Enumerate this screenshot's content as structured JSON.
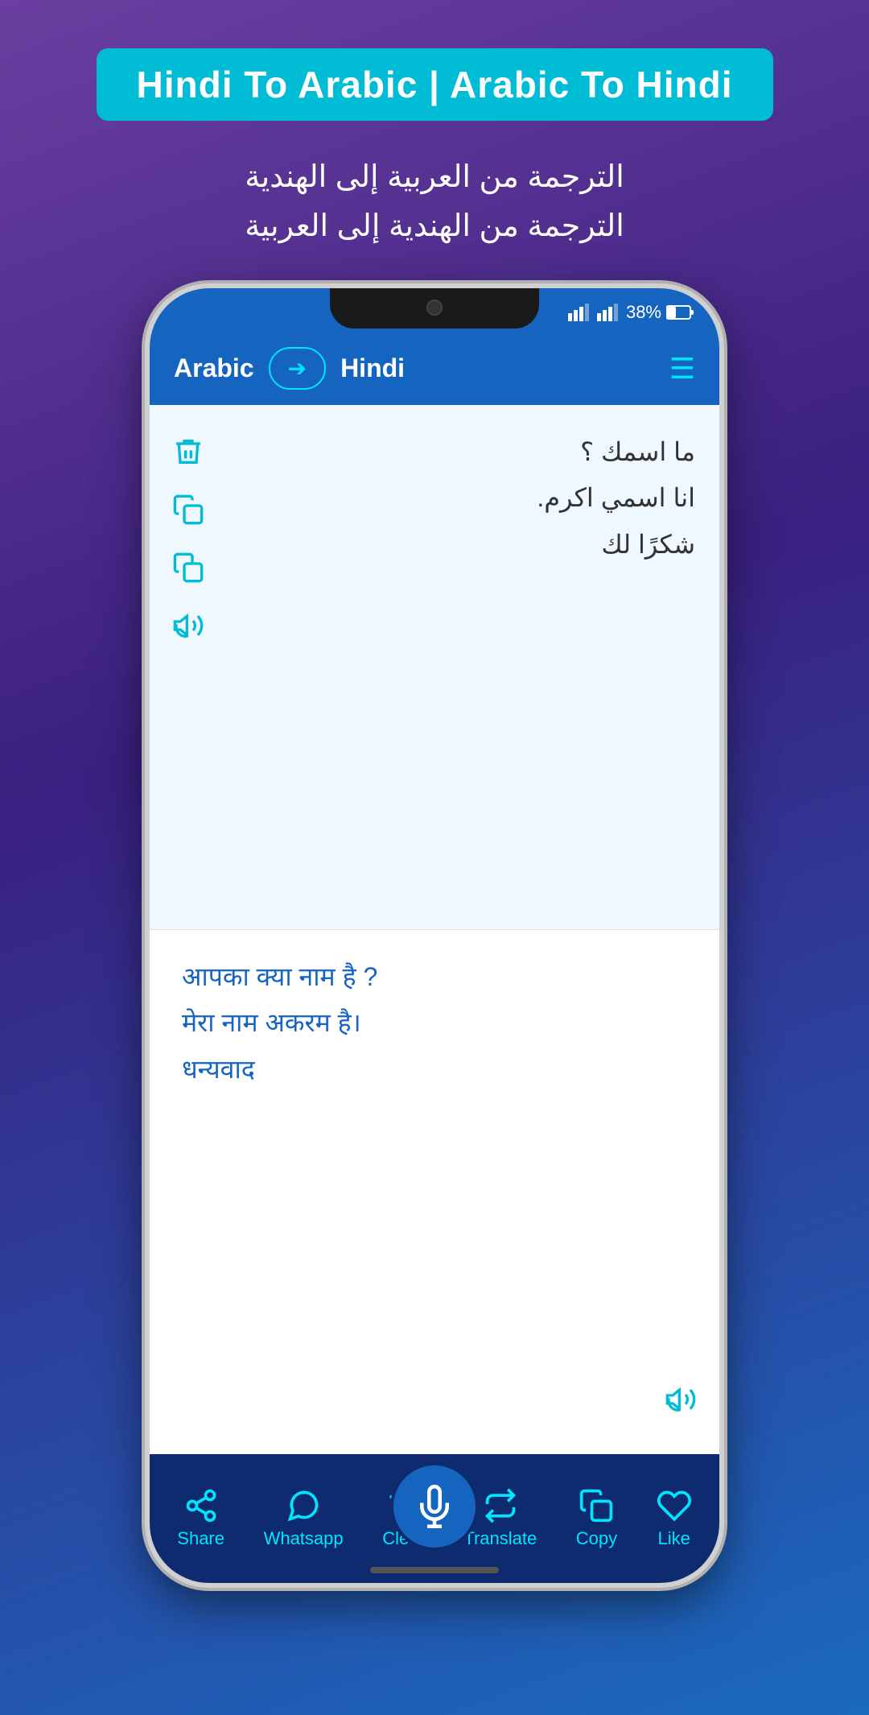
{
  "header": {
    "title": "Hindi To Arabic | Arabic To Hindi",
    "subtitle_line1": "الترجمة من العربية إلى الهندية",
    "subtitle_line2": "الترجمة من الهندية إلى العربية"
  },
  "app_bar": {
    "lang_from": "Arabic",
    "lang_to": "Hindi"
  },
  "status_bar": {
    "battery": "38%"
  },
  "input_panel": {
    "line1": "ما اسمك ؟",
    "line2": "انا اسمي اكرم.",
    "line3": "شكرًا لك"
  },
  "output_panel": {
    "line1": "आपका क्या नाम है ?",
    "line2": "मेरा नाम अकरम है।",
    "line3": "धन्यवाद"
  },
  "bottom_nav": {
    "items": [
      {
        "id": "share",
        "label": "Share"
      },
      {
        "id": "whatsapp",
        "label": "Whatsapp"
      },
      {
        "id": "clear",
        "label": "Clear"
      },
      {
        "id": "mic",
        "label": ""
      },
      {
        "id": "translate",
        "label": "Translate"
      },
      {
        "id": "copy",
        "label": "Copy"
      },
      {
        "id": "like",
        "label": "Like"
      }
    ]
  },
  "colors": {
    "accent": "#00bcd4",
    "app_bar": "#1565c0",
    "nav_bg": "#0d2b6e"
  }
}
